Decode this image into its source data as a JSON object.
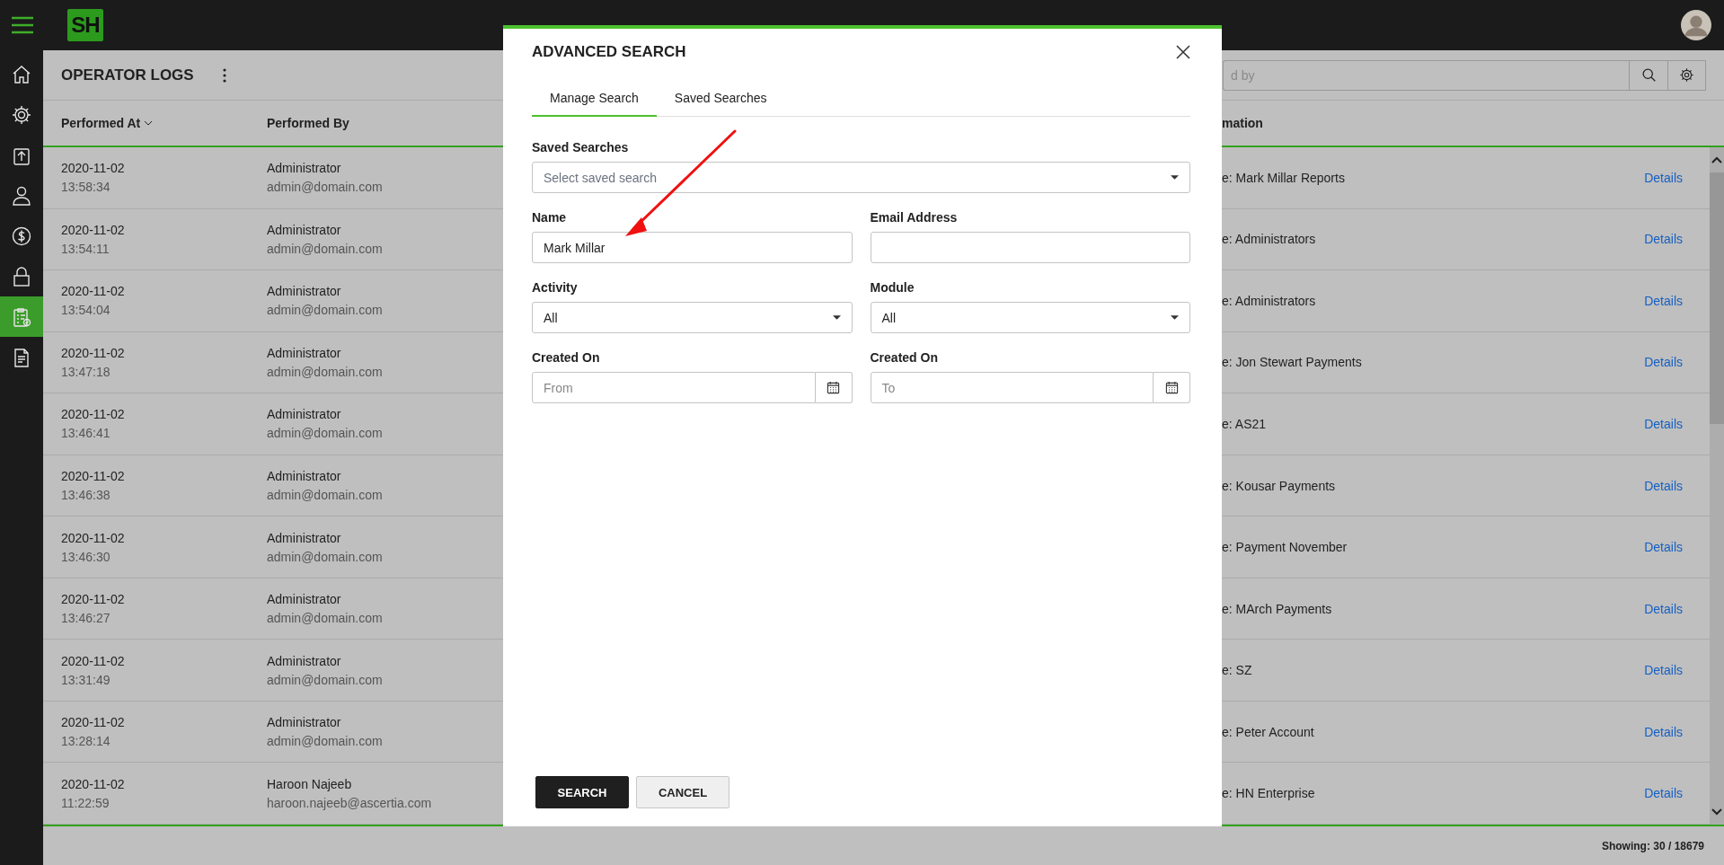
{
  "top_bar": {
    "logo": "SH"
  },
  "sidebar": {
    "items": [
      {
        "selected": false
      },
      {
        "selected": false
      },
      {
        "selected": false
      },
      {
        "selected": false
      },
      {
        "selected": false
      },
      {
        "selected": false
      },
      {
        "selected": true
      },
      {
        "selected": false
      }
    ]
  },
  "page": {
    "title": "OPERATOR LOGS"
  },
  "search": {
    "placeholder": "d by"
  },
  "table": {
    "columns": [
      {
        "label": "Performed At",
        "sorted": true
      },
      {
        "label": "Performed By",
        "sorted": false
      },
      {
        "label": "mation",
        "sorted": false
      }
    ],
    "rows": [
      {
        "date": "2020-11-02",
        "time": "13:58:34",
        "user": "Administrator",
        "email": "admin@domain.com",
        "info": "e: Mark Millar Reports",
        "action": "Details"
      },
      {
        "date": "2020-11-02",
        "time": "13:54:11",
        "user": "Administrator",
        "email": "admin@domain.com",
        "info": "e: Administrators",
        "action": "Details"
      },
      {
        "date": "2020-11-02",
        "time": "13:54:04",
        "user": "Administrator",
        "email": "admin@domain.com",
        "info": "e: Administrators",
        "action": "Details"
      },
      {
        "date": "2020-11-02",
        "time": "13:47:18",
        "user": "Administrator",
        "email": "admin@domain.com",
        "info": "e: Jon Stewart Payments",
        "action": "Details"
      },
      {
        "date": "2020-11-02",
        "time": "13:46:41",
        "user": "Administrator",
        "email": "admin@domain.com",
        "info": "e: AS21",
        "action": "Details"
      },
      {
        "date": "2020-11-02",
        "time": "13:46:38",
        "user": "Administrator",
        "email": "admin@domain.com",
        "info": "e: Kousar Payments",
        "action": "Details"
      },
      {
        "date": "2020-11-02",
        "time": "13:46:30",
        "user": "Administrator",
        "email": "admin@domain.com",
        "info": "e: Payment November",
        "action": "Details"
      },
      {
        "date": "2020-11-02",
        "time": "13:46:27",
        "user": "Administrator",
        "email": "admin@domain.com",
        "info": "e: MArch Payments",
        "action": "Details"
      },
      {
        "date": "2020-11-02",
        "time": "13:31:49",
        "user": "Administrator",
        "email": "admin@domain.com",
        "info": "e: SZ",
        "action": "Details"
      },
      {
        "date": "2020-11-02",
        "time": "13:28:14",
        "user": "Administrator",
        "email": "admin@domain.com",
        "info": "e: Peter Account",
        "action": "Details"
      },
      {
        "date": "2020-11-02",
        "time": "11:22:59",
        "user": "Haroon Najeeb",
        "email": "haroon.najeeb@ascertia.com",
        "info": "e: HN Enterprise",
        "action": "Details"
      }
    ]
  },
  "footer": {
    "showing": "Showing: 30 / 18679"
  },
  "dialog": {
    "title": "ADVANCED SEARCH",
    "tabs": [
      {
        "label": "Manage Search",
        "selected": true
      },
      {
        "label": "Saved Searches",
        "selected": false
      }
    ],
    "form_rows": [
      [
        {
          "kind": "select",
          "label": "Saved Searches",
          "placeholder": "Select saved search"
        }
      ],
      [
        {
          "kind": "text",
          "label": "Name",
          "value": "Mark Millar"
        },
        {
          "kind": "text",
          "label": "Email Address"
        }
      ],
      [
        {
          "kind": "select",
          "label": "Activity",
          "value": "All"
        },
        {
          "kind": "select",
          "label": "Module",
          "value": "All"
        }
      ],
      [
        {
          "kind": "date",
          "label": "Created On",
          "placeholder": "From"
        },
        {
          "kind": "date",
          "label": "Created On",
          "placeholder": "To"
        }
      ]
    ],
    "buttons": [
      {
        "label": "SEARCH",
        "kind": "primary"
      },
      {
        "label": "CANCEL",
        "kind": "secondary"
      }
    ]
  }
}
